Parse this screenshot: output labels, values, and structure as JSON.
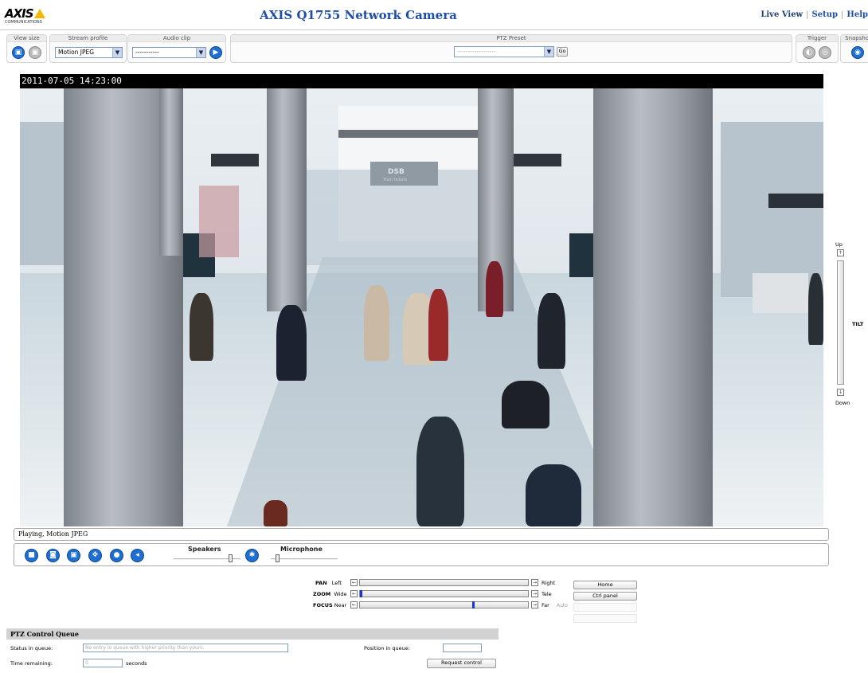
{
  "header": {
    "logo_text": "AXIS",
    "logo_sub": "COMMUNICATIONS",
    "title": "AXIS Q1755 Network Camera",
    "nav": [
      {
        "label": "Live View"
      },
      {
        "label": "Setup"
      },
      {
        "label": "Help"
      }
    ],
    "nav_sep": "|"
  },
  "toolbar": {
    "view_size": {
      "label": "View size"
    },
    "stream_profile": {
      "label": "Stream profile",
      "value": "Motion JPEG"
    },
    "audio_clip": {
      "label": "Audio clip",
      "value": "-----------"
    },
    "ptz_preset": {
      "label": "PTZ Preset",
      "value": "------------------",
      "go_label": "Go"
    },
    "trigger": {
      "label": "Trigger"
    },
    "snapshot": {
      "label": "Snapshot"
    }
  },
  "video": {
    "timestamp": "2011-07-05 14:23:00",
    "sign_text": "DSB",
    "sign_sub": "Train tickets"
  },
  "status": {
    "text": "Playing, Motion JPEG"
  },
  "controls": {
    "speakers_label": "Speakers",
    "microphone_label": "Microphone",
    "speaker_volume": 0.85,
    "mic_volume": 0.1
  },
  "ptz": {
    "pan": {
      "label": "PAN",
      "min": "Left",
      "max": "Right"
    },
    "zoom": {
      "label": "ZOOM",
      "min": "Wide",
      "max": "Tele",
      "value": 0.0
    },
    "focus": {
      "label": "FOCUS",
      "min": "Near",
      "max": "Far",
      "extra": "Auto",
      "value": 0.68
    },
    "home_label": "Home",
    "ctrl_panel_label": "Ctrl panel",
    "tilt": {
      "label": "TILT",
      "up": "Up",
      "down": "Down"
    }
  },
  "queue": {
    "title": "PTZ Control Queue",
    "status_label": "Status in queue:",
    "status_value": "No entry in queue with higher priority than yours.",
    "position_label": "Position in queue:",
    "position_value": "",
    "time_label": "Time remaining:",
    "time_value": "0",
    "seconds_label": "seconds",
    "request_label": "Request control"
  },
  "colors": {
    "accent": "#1f4ea8",
    "button": "#1e6fd1",
    "logo_yellow": "#f5b800"
  }
}
